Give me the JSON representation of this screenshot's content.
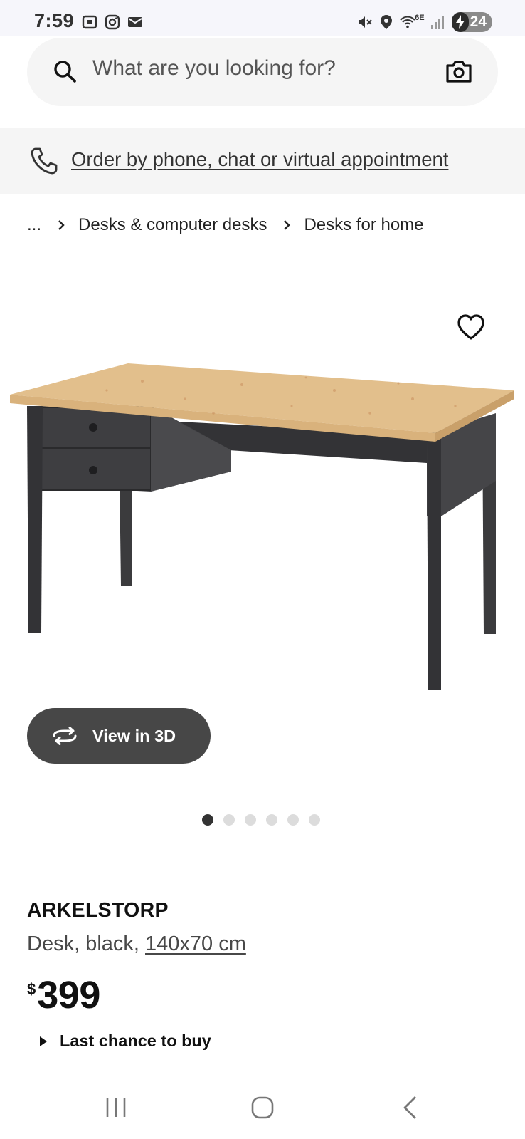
{
  "status_bar": {
    "time": "7:59",
    "network": "6E",
    "battery": "24",
    "icons": [
      "screenshot-icon",
      "instagram-icon",
      "mail-icon",
      "mute-icon",
      "location-icon",
      "wifi-icon",
      "signal-icon",
      "battery-charging-icon"
    ]
  },
  "search": {
    "placeholder": "What are you looking for?"
  },
  "order_banner": {
    "link_text": "Order by phone, chat or virtual appointment"
  },
  "breadcrumb": {
    "ellipsis": "...",
    "items": [
      "Desks & computer desks",
      "Desks for home"
    ]
  },
  "gallery": {
    "view_3d_label": "View in 3D",
    "dot_count": 6,
    "active_dot": 1
  },
  "product": {
    "name": "ARKELSTORP",
    "description_prefix": "Desk, black, ",
    "size": "140x70 cm",
    "currency": "$",
    "price": "399",
    "availability": "Last chance to buy"
  },
  "colors": {
    "accent_dark": "#474747",
    "background_soft": "#f5f5f5"
  }
}
